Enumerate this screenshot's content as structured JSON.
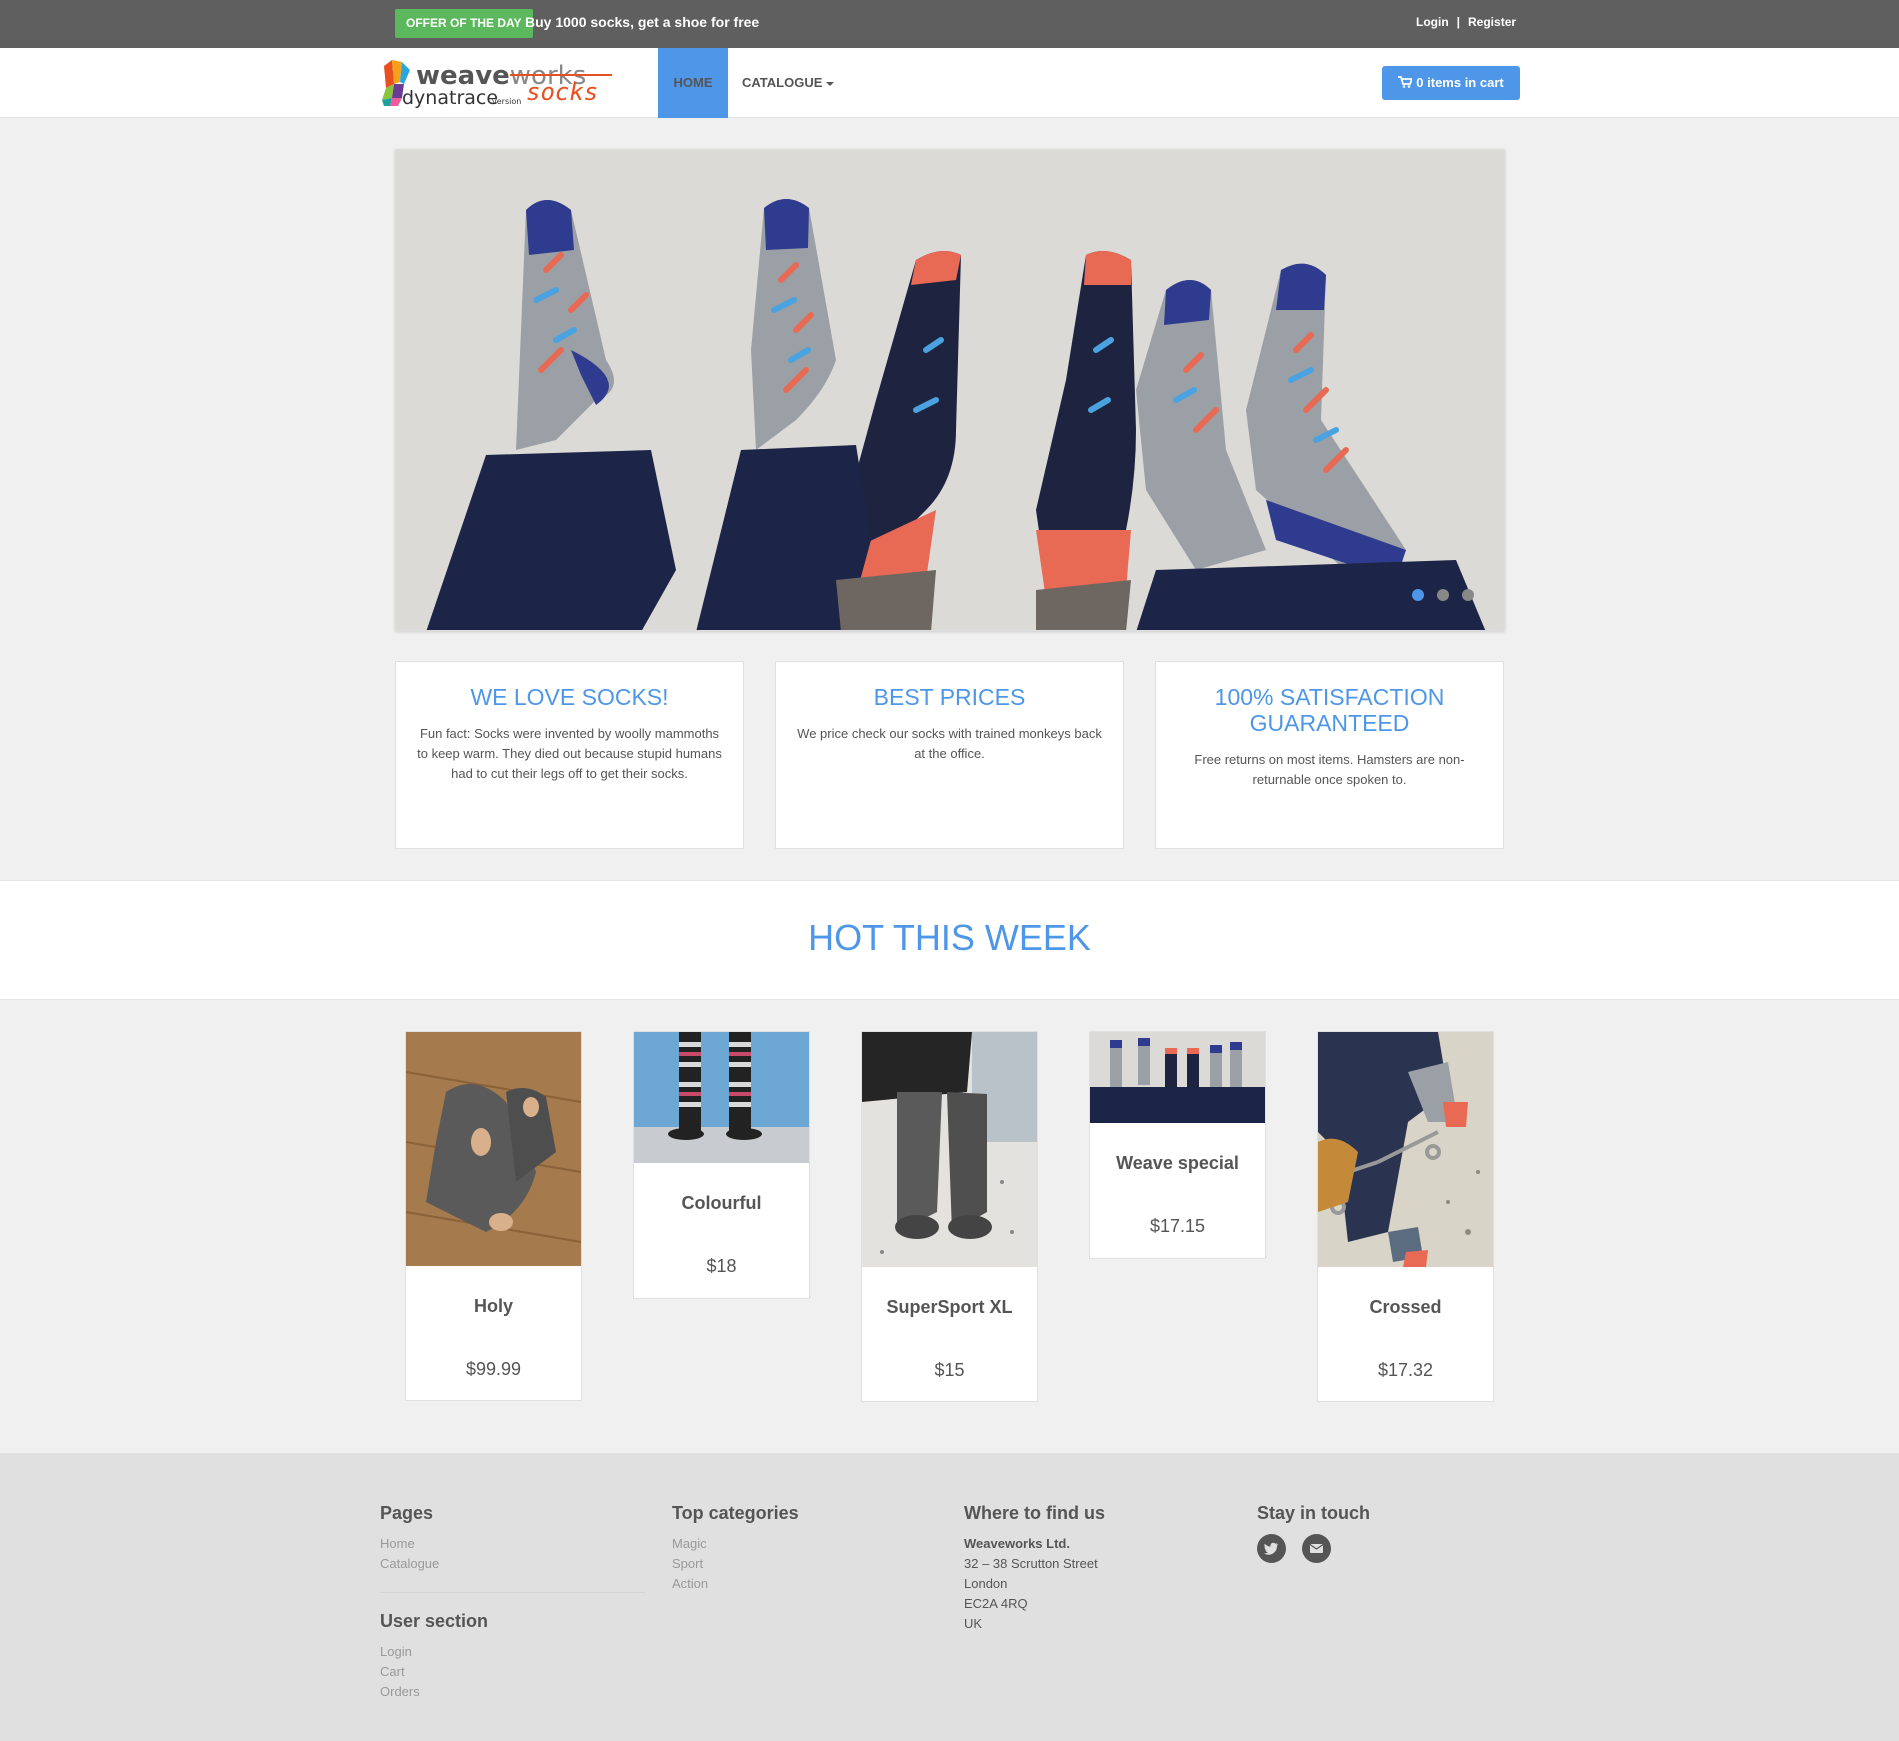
{
  "topbar": {
    "offer_badge": "OFFER OF THE DAY",
    "offer_text": "Buy 1000 socks, get a shoe for free",
    "login": "Login",
    "separator": "|",
    "register": "Register"
  },
  "navbar": {
    "home": "HOME",
    "catalogue": "CATALOGUE",
    "cart": "0 items in cart"
  },
  "carousel": {
    "slides": 3,
    "active": 1
  },
  "info_boxes": [
    {
      "title": "WE LOVE SOCKS!",
      "text": "Fun fact: Socks were invented by woolly mammoths to keep warm. They died out because stupid humans had to cut their legs off to get their socks."
    },
    {
      "title": "BEST PRICES",
      "text": "We price check our socks with trained monkeys back at the office."
    },
    {
      "title": "100% SATISFACTION GUARANTEED",
      "text": "Free returns on most items. Hamsters are non-returnable once spoken to."
    }
  ],
  "hot_title": "HOT THIS WEEK",
  "products": [
    {
      "name": "Holy",
      "price": "$99.99"
    },
    {
      "name": "Colourful",
      "price": "$18"
    },
    {
      "name": "SuperSport XL",
      "price": "$15"
    },
    {
      "name": "Weave special",
      "price": "$17.15"
    },
    {
      "name": "Crossed",
      "price": "$17.32"
    }
  ],
  "footer": {
    "pages": {
      "title": "Pages",
      "links": [
        "Home",
        "Catalogue"
      ]
    },
    "user_section": {
      "title": "User section",
      "links": [
        "Login",
        "Cart",
        "Orders"
      ]
    },
    "categories": {
      "title": "Top categories",
      "links": [
        "Magic",
        "Sport",
        "Action"
      ]
    },
    "where": {
      "title": "Where to find us",
      "company": "Weaveworks Ltd.",
      "lines": [
        "32 – 38 Scrutton Street",
        "London",
        "EC2A 4RQ",
        "UK"
      ]
    },
    "stay": {
      "title": "Stay in touch",
      "icons": [
        "twitter-icon",
        "envelope-icon"
      ]
    }
  },
  "colors": {
    "accent": "#4e97e8",
    "offer_green": "#5cb85c",
    "topbar": "#5f5f5f"
  }
}
